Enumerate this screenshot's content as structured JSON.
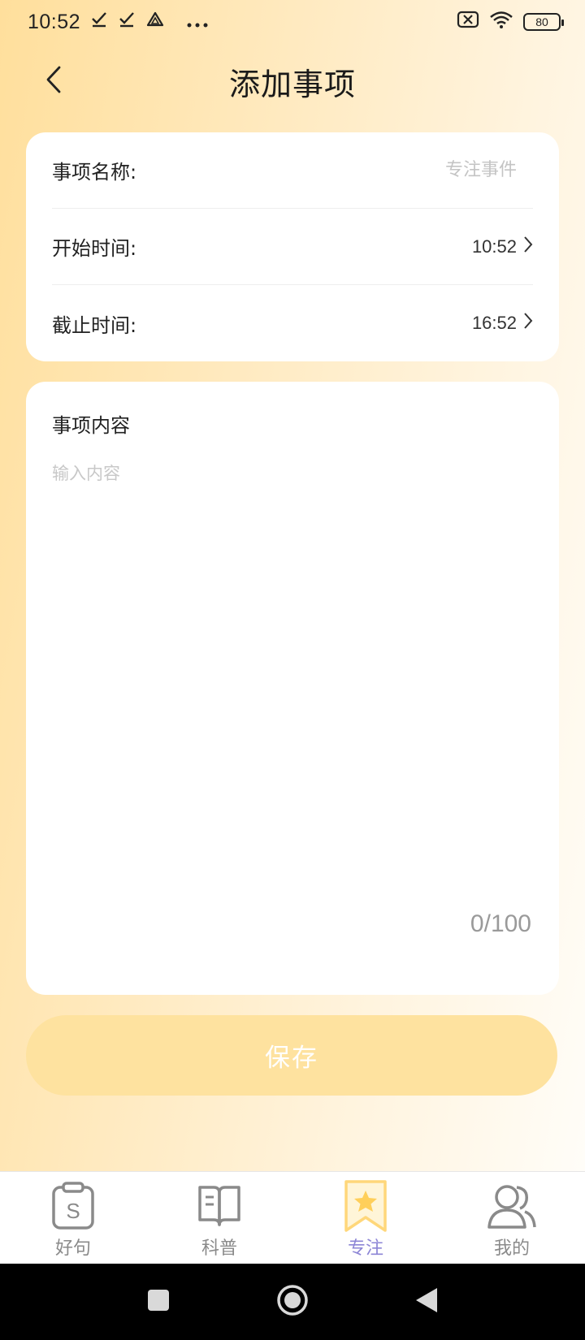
{
  "status_bar": {
    "time": "10:52",
    "battery": "80",
    "icons": [
      "check-download-icon",
      "check-download-icon",
      "drive-icon",
      "more-dots-icon",
      "sim-off-icon",
      "wifi-icon",
      "battery-icon"
    ]
  },
  "header": {
    "title": "添加事项",
    "back_icon": "chevron-left-icon"
  },
  "form": {
    "name_label": "事项名称:",
    "name_placeholder": "专注事件",
    "start_label": "开始时间:",
    "start_value": "10:52",
    "end_label": "截止时间:",
    "end_value": "16:52"
  },
  "content": {
    "title": "事项内容",
    "placeholder": "输入内容",
    "counter": "0/100"
  },
  "save_label": "保存",
  "tabs": [
    {
      "label": "好句",
      "icon": "clipboard-s-icon",
      "active": false
    },
    {
      "label": "科普",
      "icon": "open-book-icon",
      "active": false
    },
    {
      "label": "专注",
      "icon": "bookmark-star-icon",
      "active": true
    },
    {
      "label": "我的",
      "icon": "users-icon",
      "active": false
    }
  ],
  "colors": {
    "accent": "#fee29f",
    "tab_active": "#8d86d6",
    "tab_inactive": "#8a8a8a"
  }
}
